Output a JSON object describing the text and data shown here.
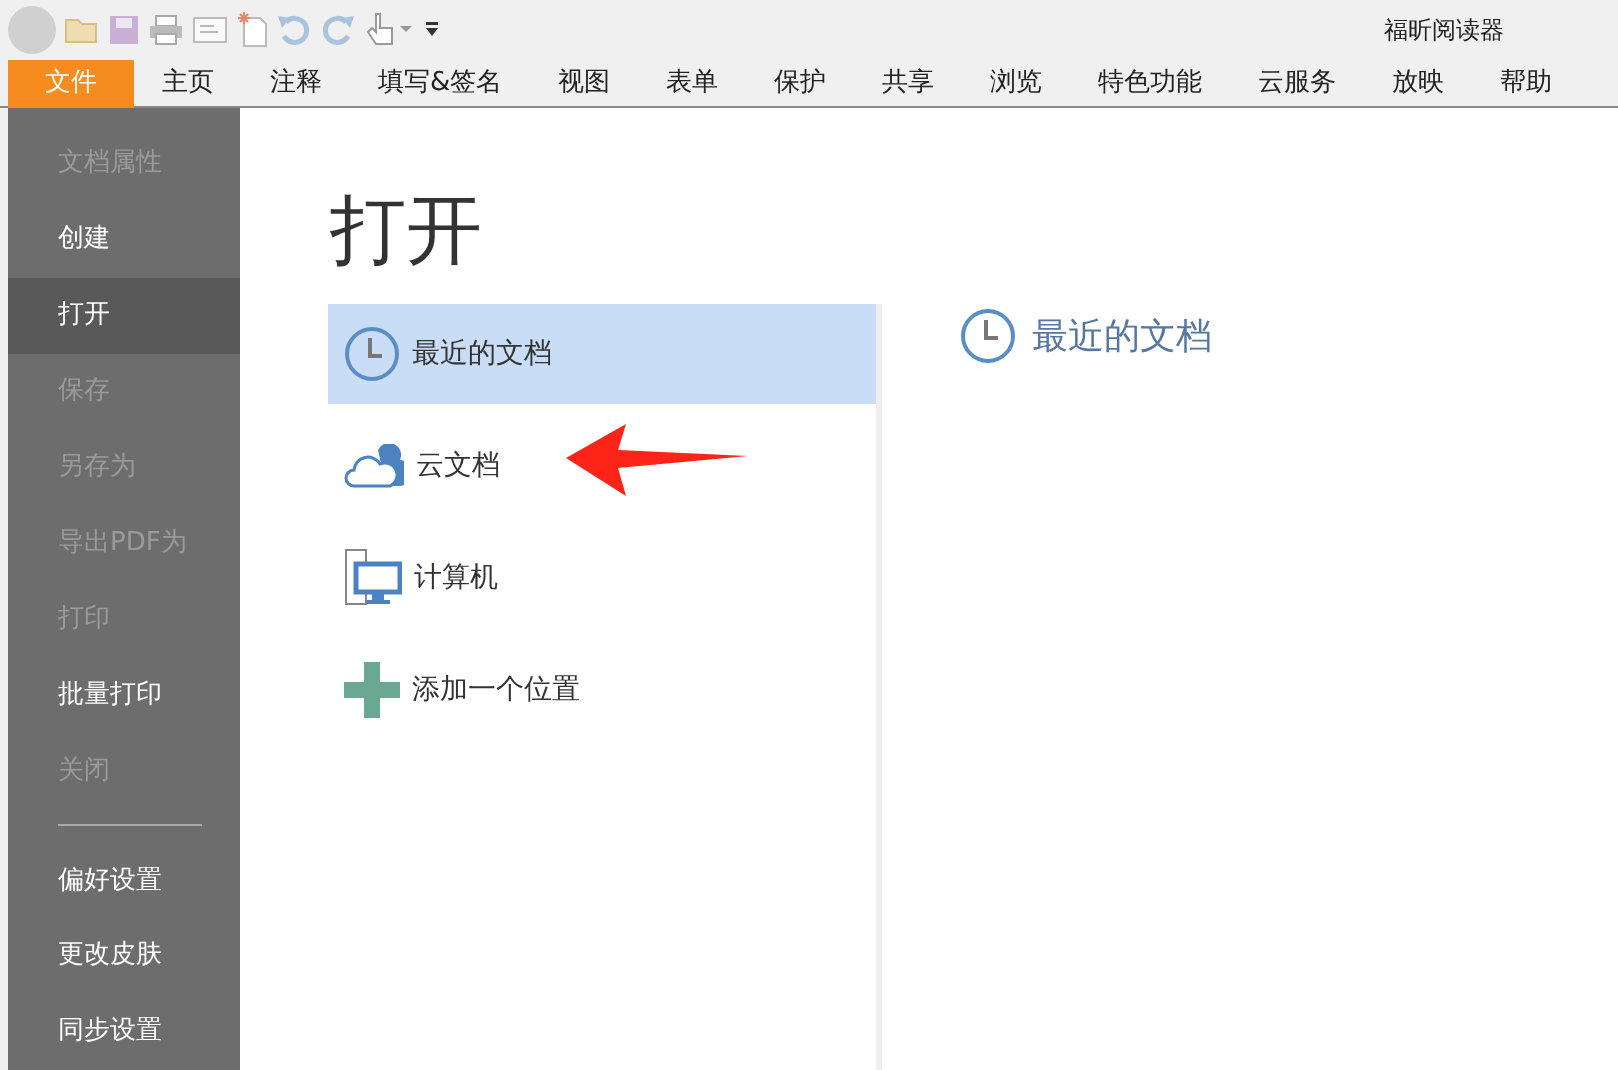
{
  "window": {
    "title": "福昕阅读器"
  },
  "menu_tabs": [
    {
      "label": "文件",
      "selected": true
    },
    {
      "label": "主页",
      "selected": false
    },
    {
      "label": "注释",
      "selected": false
    },
    {
      "label": "填写&签名",
      "selected": false
    },
    {
      "label": "视图",
      "selected": false
    },
    {
      "label": "表单",
      "selected": false
    },
    {
      "label": "保护",
      "selected": false
    },
    {
      "label": "共享",
      "selected": false
    },
    {
      "label": "浏览",
      "selected": false
    },
    {
      "label": "特色功能",
      "selected": false
    },
    {
      "label": "云服务",
      "selected": false
    },
    {
      "label": "放映",
      "selected": false
    },
    {
      "label": "帮助",
      "selected": false
    }
  ],
  "sidebar": {
    "items": [
      {
        "kind": "item",
        "label": "文档属性",
        "disabled": true,
        "selected": false
      },
      {
        "kind": "item",
        "label": "创建",
        "disabled": false,
        "selected": false
      },
      {
        "kind": "item",
        "label": "打开",
        "disabled": false,
        "selected": true
      },
      {
        "kind": "item",
        "label": "保存",
        "disabled": true,
        "selected": false
      },
      {
        "kind": "item",
        "label": "另存为",
        "disabled": true,
        "selected": false
      },
      {
        "kind": "item",
        "label": "导出PDF为",
        "disabled": true,
        "selected": false
      },
      {
        "kind": "item",
        "label": "打印",
        "disabled": true,
        "selected": false
      },
      {
        "kind": "item",
        "label": "批量打印",
        "disabled": false,
        "selected": false
      },
      {
        "kind": "item",
        "label": "关闭",
        "disabled": true,
        "selected": false
      },
      {
        "kind": "divider"
      },
      {
        "kind": "item",
        "label": "偏好设置",
        "disabled": false,
        "selected": false
      },
      {
        "kind": "item",
        "label": "更改皮肤",
        "disabled": false,
        "selected": false
      },
      {
        "kind": "item",
        "label": "同步设置",
        "disabled": false,
        "selected": false
      }
    ]
  },
  "page_title": "打开",
  "places": [
    {
      "kind": "recent",
      "label": "最近的文档",
      "selected": true
    },
    {
      "kind": "cloud",
      "label": "云文档",
      "selected": false
    },
    {
      "kind": "computer",
      "label": "计算机",
      "selected": false
    },
    {
      "kind": "add",
      "label": "添加一个位置",
      "selected": false
    }
  ],
  "detail": {
    "heading": "最近的文档"
  }
}
